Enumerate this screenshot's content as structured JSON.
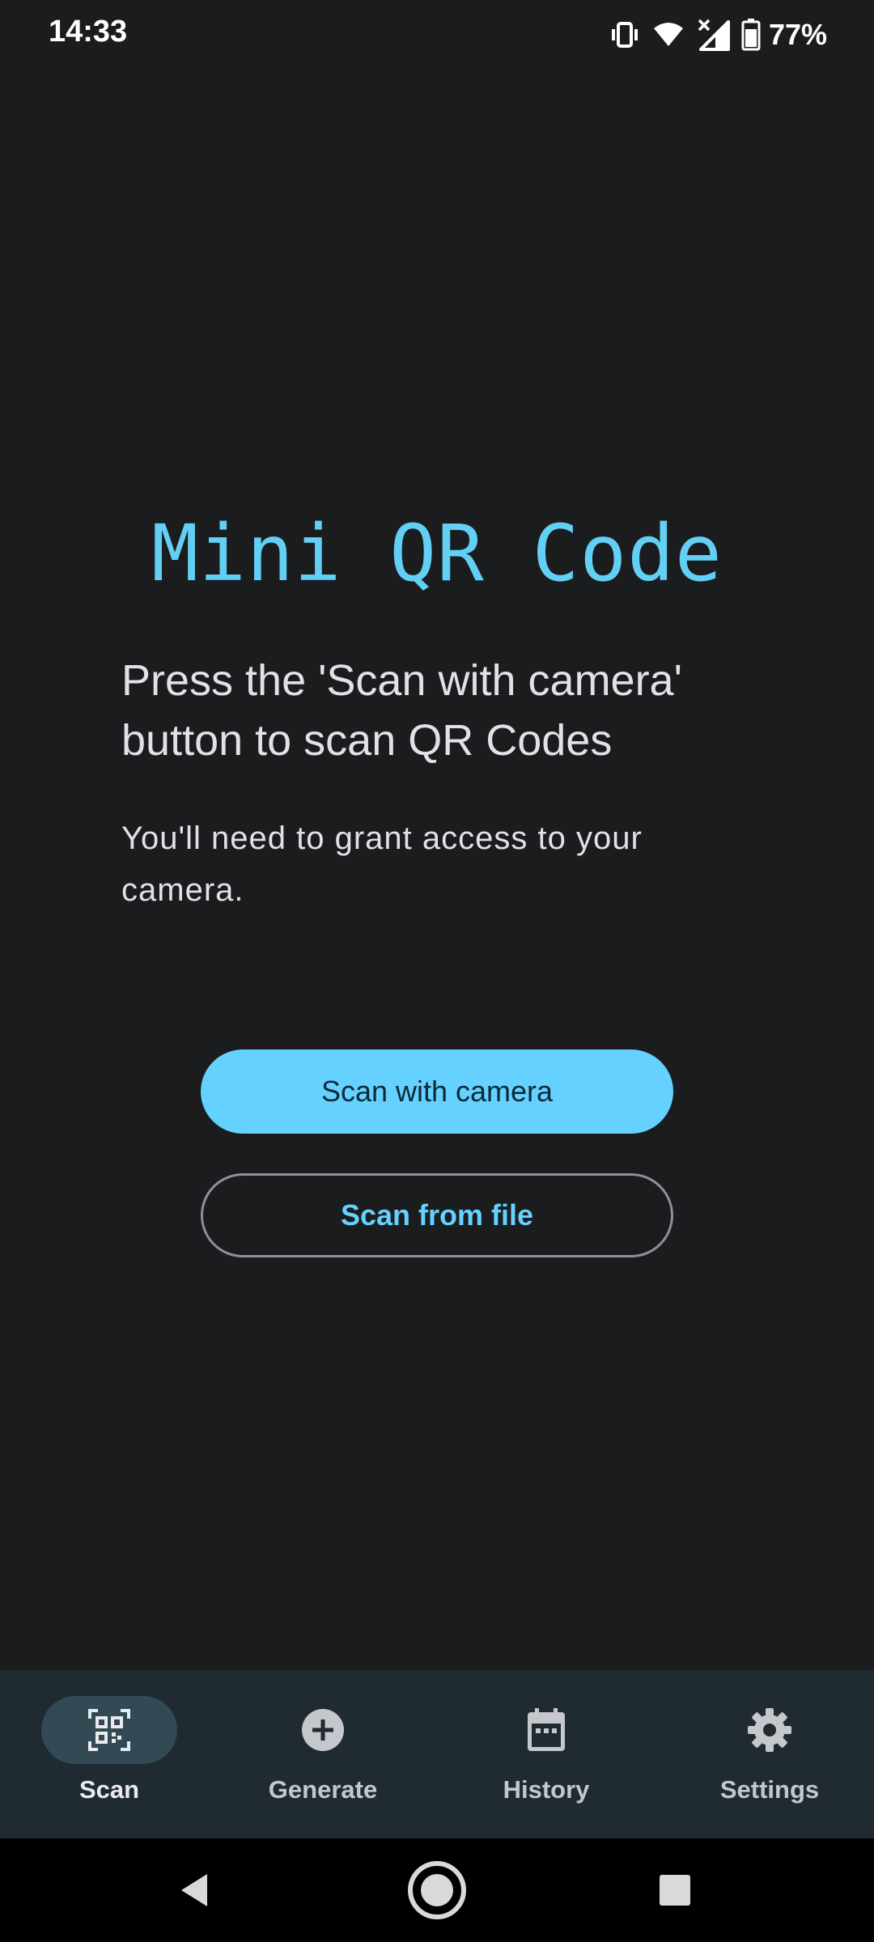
{
  "status_bar": {
    "time": "14:33",
    "battery_percent": "77%",
    "icons": [
      "vibrate-icon",
      "wifi-icon",
      "signal-icon",
      "battery-icon"
    ]
  },
  "main": {
    "app_title": "Mini QR Code",
    "headline": "Press the 'Scan with camera' button to scan QR Codes",
    "subtext": "You'll need to grant access to your camera.",
    "primary_button": "Scan with camera",
    "secondary_button": "Scan from file"
  },
  "bottom_nav": {
    "items": [
      {
        "label": "Scan",
        "icon": "qr-scan-icon",
        "active": true
      },
      {
        "label": "Generate",
        "icon": "add-circle-icon",
        "active": false
      },
      {
        "label": "History",
        "icon": "calendar-icon",
        "active": false
      },
      {
        "label": "Settings",
        "icon": "gear-icon",
        "active": false
      }
    ]
  },
  "system_nav": {
    "buttons": [
      "back-icon",
      "home-icon",
      "recents-icon"
    ]
  },
  "colors": {
    "background": "#1a1c1e",
    "accent": "#65d1ff",
    "title": "#62cff4",
    "nav_background": "#202a31",
    "nav_active_pill": "#334953"
  }
}
